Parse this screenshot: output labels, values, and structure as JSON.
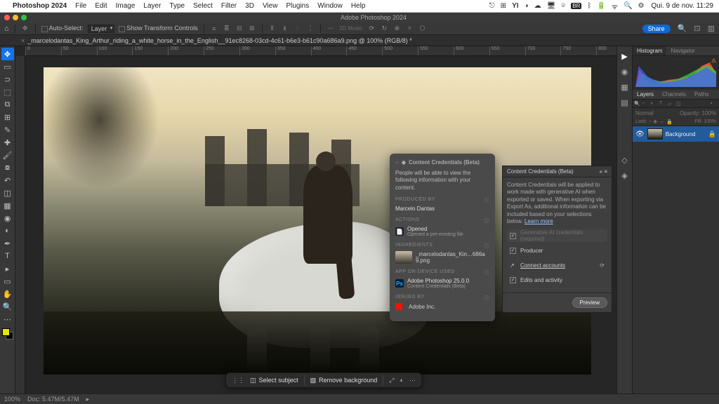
{
  "menubar": {
    "app": "Photoshop 2024",
    "items": [
      "File",
      "Edit",
      "Image",
      "Layer",
      "Type",
      "Select",
      "Filter",
      "3D",
      "View",
      "Plugins",
      "Window",
      "Help"
    ],
    "clock": "Qui. 9 de nov.  11:29"
  },
  "window_title": "Adobe Photoshop 2024",
  "options": {
    "auto_select": "Auto-Select:",
    "auto_select_target": "Layer",
    "show_transform": "Show Transform Controls",
    "share": "Share"
  },
  "document": {
    "tab": "_marcelodantas_King_Arthur_riding_a_white_horse_in_the_English__91ec8268-03cd-4c61-b6e3-b61c90a686a9.png @ 100% (RGB/8) *"
  },
  "ruler_ticks": [
    "0",
    "50",
    "100",
    "150",
    "200",
    "250",
    "300",
    "350",
    "400",
    "450",
    "500",
    "550",
    "600",
    "650",
    "700",
    "750",
    "800"
  ],
  "cc_card": {
    "title": "Content Credentials (Beta)",
    "intro": "People will be able to view the following information with your content.",
    "produced_by_label": "PRODUCED BY",
    "produced_by": "Marcelo Dantas",
    "actions_label": "ACTIONS",
    "action_title": "Opened",
    "action_sub": "Opened a pre-existing file",
    "ingredients_label": "INGREDIENTS",
    "ingredient_file": "_marcelodantas_Kin…686a9.png",
    "app_used_label": "APP OR DEVICE USED",
    "app_used": "Adobe Photoshop 25.0.0",
    "app_used_sub": "Content Credentials (Beta)",
    "issued_by_label": "ISSUED BY",
    "issued_by": "Adobe Inc."
  },
  "cc_panel": {
    "title": "Content Credentials (Beta)",
    "intro_1": "Content Credentials will be applied to work made with generative AI when exported or saved. When exporting via Export As, additional information can be included based on your selections below. ",
    "learn_more": "Learn more",
    "opt_genai": "Generative AI credentials (required)",
    "opt_producer": "Producer",
    "opt_connect": "Connect accounts",
    "opt_edits": "Edits and activity",
    "preview": "Preview"
  },
  "ctxbar": {
    "select_subject": "Select subject",
    "remove_bg": "Remove background"
  },
  "right_panels": {
    "histogram_tab": "Histogram",
    "navigator_tab": "Navigator",
    "layers_tab": "Layers",
    "channels_tab": "Channels",
    "paths_tab": "Paths",
    "blend_mode": "Normal",
    "opacity_label": "Opacity",
    "opacity_val": "100%",
    "lock_label": "Lock:",
    "fill_label": "Fill:",
    "fill_val": "100%",
    "layer_name": "Background"
  },
  "status": {
    "zoom": "100%",
    "doc": "Doc: 5.47M/5.47M"
  }
}
